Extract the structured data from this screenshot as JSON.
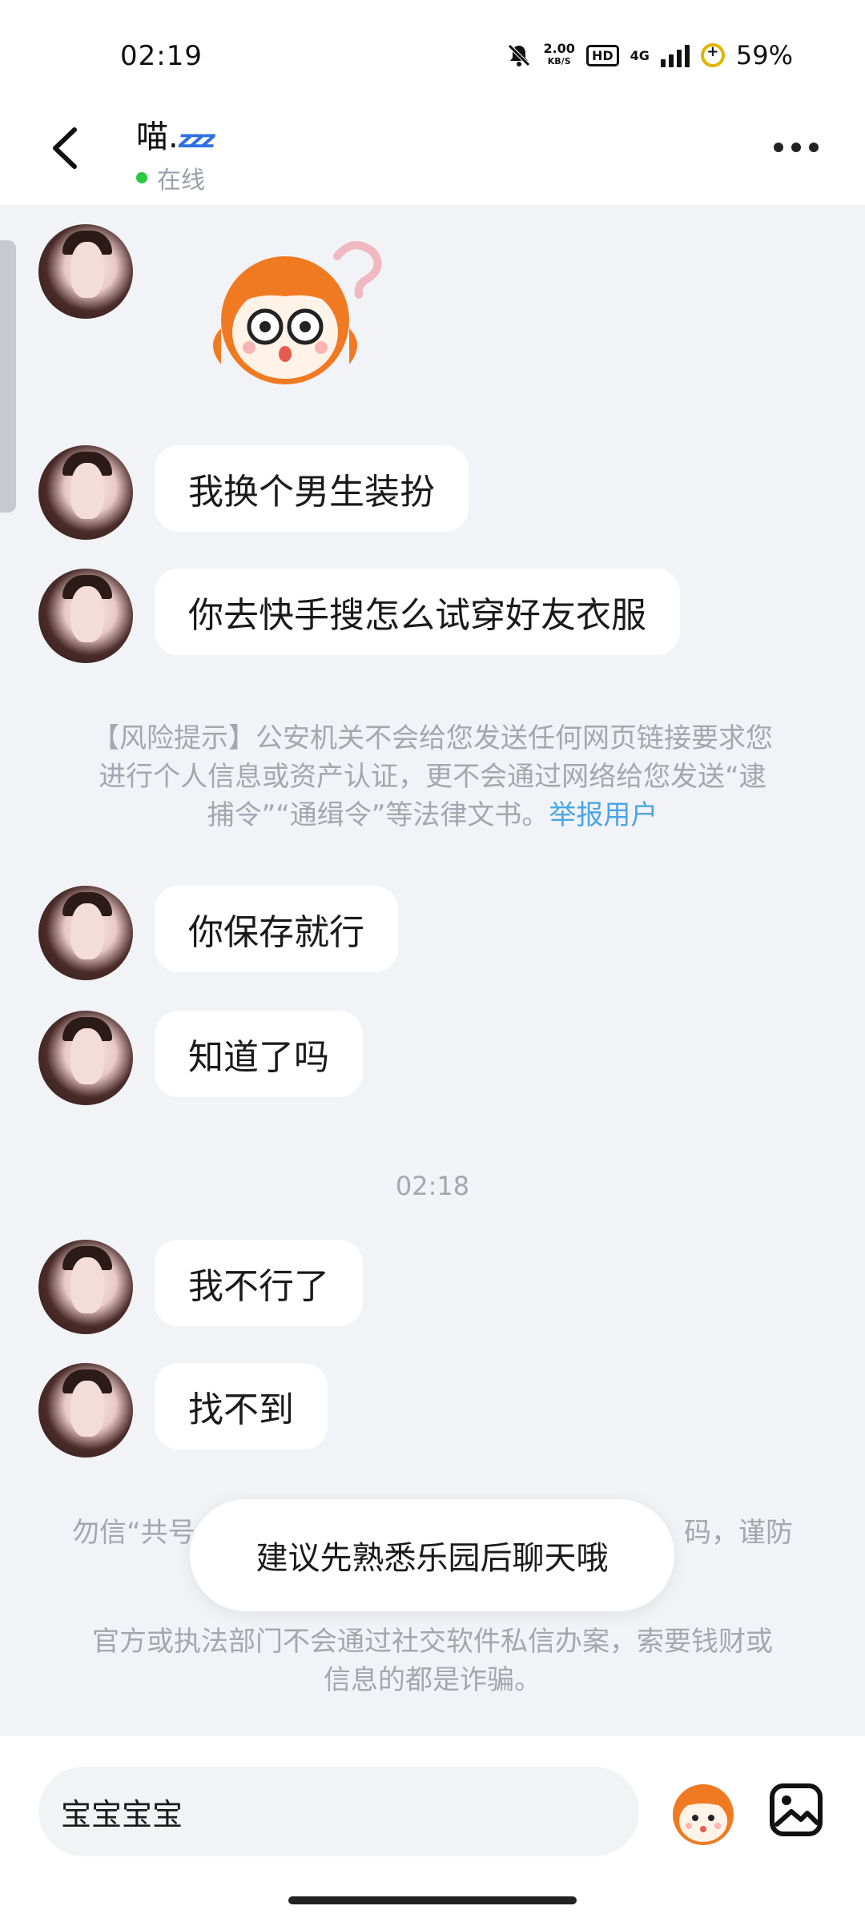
{
  "status_bar": {
    "time": "02:19",
    "net_speed_top": "2.00",
    "net_speed_unit": "KB/S",
    "hd_badge": "HD",
    "network_type": "4G",
    "battery": "59%"
  },
  "header": {
    "contact_name": "喵.",
    "sleep_badge": "zzz",
    "status": "在线"
  },
  "messages": [
    {
      "type": "sticker",
      "icon": "cartoon-face-sticker"
    },
    {
      "type": "text",
      "text": "我换个男生装扮"
    },
    {
      "type": "text",
      "text": "你去快手搜怎么试穿好友衣服"
    },
    {
      "type": "text",
      "text": "你保存就行"
    },
    {
      "type": "text",
      "text": "知道了吗"
    },
    {
      "type": "text",
      "text": "我不行了"
    },
    {
      "type": "text",
      "text": "找不到"
    }
  ],
  "notices": {
    "risk_line1": "【风险提示】公安机关不会给您发送任何网页链接要求您",
    "risk_line2": "进行个人信息或资产认证，更不会通过网络给您发送“逮",
    "risk_line3": "捕令”“通缉令”等法律文书。",
    "report_link": "举报用户",
    "partial_left": "勿信“共号",
    "partial_right": "码，谨防",
    "official_line1": "官方或执法部门不会通过社交软件私信办案，索要钱财或",
    "official_line2": "信息的都是诈骗。"
  },
  "timestamp": "02:18",
  "toast": "建议先熟悉乐园后聊天哦",
  "input": {
    "value": "宝宝宝宝"
  },
  "colors": {
    "accent_link": "#4aa6e6",
    "online": "#28c840",
    "background": "#f2f3f7"
  }
}
